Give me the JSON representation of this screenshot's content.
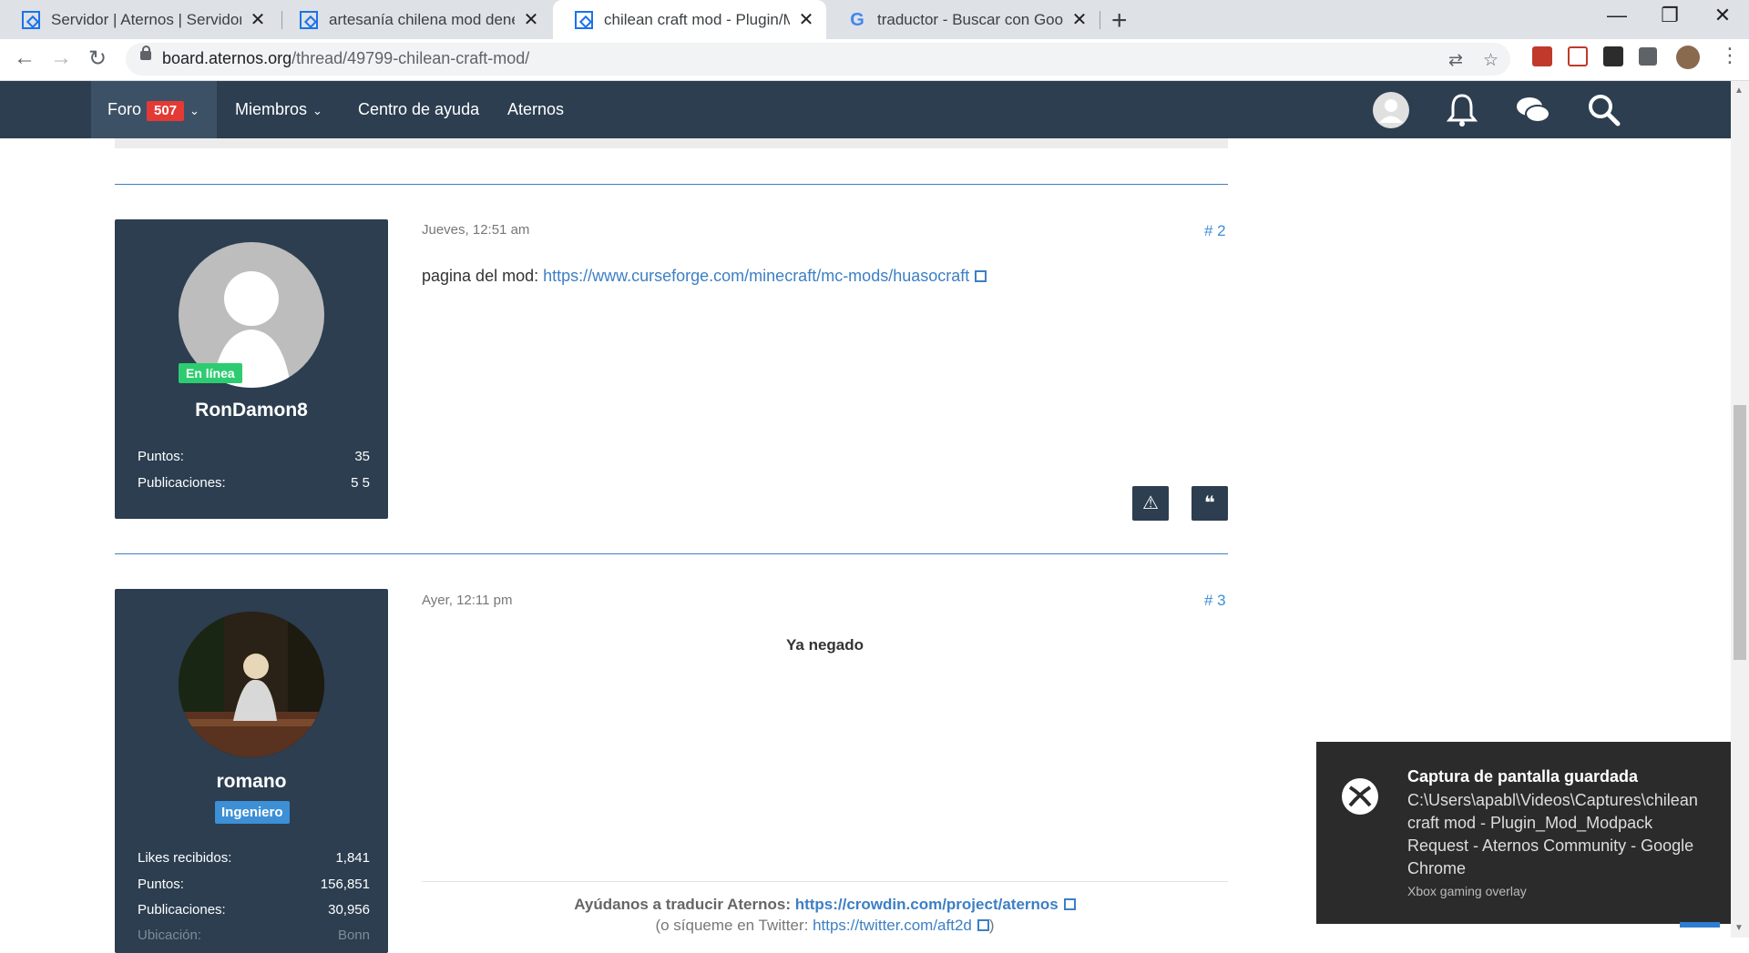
{
  "browser": {
    "tabs": [
      {
        "title": "Servidor | Aternos | Servidor de Minecraft",
        "icon": "aternos-favicon",
        "active": false
      },
      {
        "title": "artesanía chilena mod denegada",
        "icon": "aternos-favicon",
        "active": false
      },
      {
        "title": "chilean craft mod - Plugin/Mod/Modpack Request",
        "icon": "aternos-favicon",
        "active": true
      },
      {
        "title": "traductor - Buscar con Google",
        "icon": "google-favicon",
        "active": false
      }
    ],
    "tab_close": "✕",
    "new_tab": "+",
    "window_controls": {
      "minimize": "—",
      "restore": "❐",
      "close": "✕"
    },
    "url_host": "board.aternos.org",
    "url_path": "/thread/49799-chilean-craft-mod/"
  },
  "site_nav": {
    "foro_label": "Foro",
    "foro_badge": "507",
    "miembros_label": "Miembros",
    "ayuda_label": "Centro de ayuda",
    "aternos_label": "Aternos",
    "caret": "⌄",
    "icons": [
      "user-avatar-icon",
      "bell-icon",
      "chat-icon",
      "search-icon"
    ]
  },
  "posts": [
    {
      "username": "RonDamon8",
      "online_badge": "En línea",
      "stats": [
        {
          "label": "Puntos:",
          "value": "35"
        },
        {
          "label": "Publicaciones:",
          "value": "5 5"
        }
      ],
      "date": "Jueves, 12:51 am",
      "number": "# 2",
      "body_prefix": "pagina del mod: ",
      "link": "https://www.curseforge.com/minecraft/mc-mods/huasocraft",
      "report_icon": "⚠",
      "quote_icon": "❝"
    },
    {
      "username": "romano",
      "rank": "Ingeniero",
      "stats": [
        {
          "label": "Likes recibidos:",
          "value": "1,841"
        },
        {
          "label": "Puntos:",
          "value": "156,851"
        },
        {
          "label": "Publicaciones:",
          "value": "30,956"
        },
        {
          "label": "Ubicación:",
          "value": "Bonn"
        }
      ],
      "date": "Ayer, 12:11 pm",
      "number": "# 3",
      "body": "Ya negado",
      "signature_prefix": "Ayúdanos a traducir Aternos: ",
      "signature_link": "https://crowdin.com/project/aternos",
      "signature2_prefix": "(o síqueme en Twitter: ",
      "signature2_link": "https://twitter.com/aft2d",
      "signature2_suffix": ")"
    }
  ],
  "toast": {
    "title": "Captura de pantalla guardada",
    "body": "C:\\Users\\apabl\\Videos\\Captures\\chilean craft mod - Plugin_Mod_Modpack Request - Aternos Community - Google Chrome",
    "source": "Xbox gaming overlay"
  },
  "colors": {
    "nav_bg": "#2c3e50",
    "accent_blue": "#3d7fc4",
    "online_green": "#2ecc71",
    "badge_red": "#e53935"
  }
}
